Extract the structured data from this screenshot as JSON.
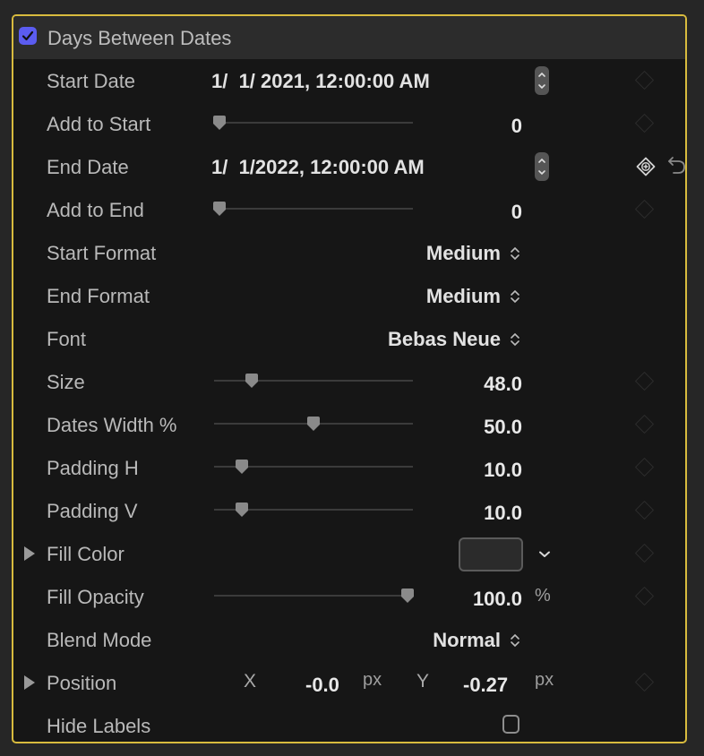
{
  "panel": {
    "title": "Days Between Dates",
    "enabled": true,
    "accent_border": "#d8bb3e",
    "checkbox_color": "#5b5cf0"
  },
  "rows": {
    "start_date": {
      "label": "Start Date",
      "value": "1/  1/ 2021, 12:00:00 AM"
    },
    "add_to_start": {
      "label": "Add to Start",
      "value": "0",
      "slider_fraction": 0.0
    },
    "end_date": {
      "label": "End Date",
      "value": "1/  1/2022, 12:00:00 AM"
    },
    "add_to_end": {
      "label": "Add to End",
      "value": "0",
      "slider_fraction": 0.0
    },
    "start_format": {
      "label": "Start Format",
      "value": "Medium"
    },
    "end_format": {
      "label": "End Format",
      "value": "Medium"
    },
    "font": {
      "label": "Font",
      "value": "Bebas Neue"
    },
    "size": {
      "label": "Size",
      "value": "48.0",
      "slider_fraction": 0.17
    },
    "dates_width": {
      "label": "Dates Width %",
      "value": "50.0",
      "slider_fraction": 0.5
    },
    "padding_h": {
      "label": "Padding H",
      "value": "10.0",
      "slider_fraction": 0.12
    },
    "padding_v": {
      "label": "Padding V",
      "value": "10.0",
      "slider_fraction": 0.12
    },
    "fill_color": {
      "label": "Fill Color",
      "color": "#2b2b2b"
    },
    "fill_opacity": {
      "label": "Fill Opacity",
      "value": "100.0",
      "unit": "%",
      "slider_fraction": 1.0
    },
    "blend_mode": {
      "label": "Blend Mode",
      "value": "Normal"
    },
    "position": {
      "label": "Position",
      "x_label": "X",
      "x_value": "-0.0",
      "y_label": "Y",
      "y_value": "-0.27",
      "unit": "px"
    },
    "hide_labels": {
      "label": "Hide Labels",
      "checked": false
    }
  }
}
